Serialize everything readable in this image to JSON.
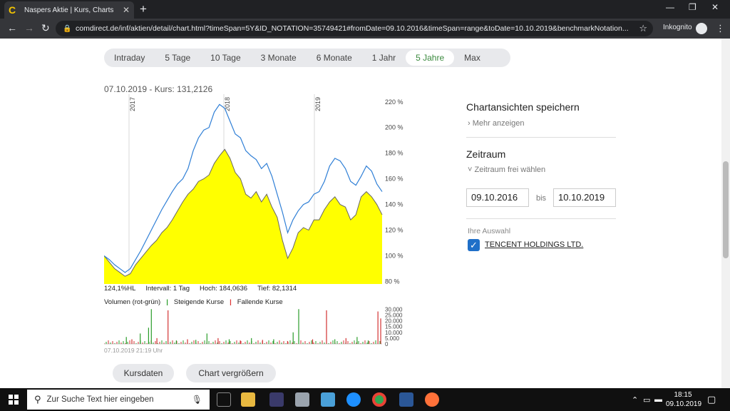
{
  "browser": {
    "tab_title": "Naspers Aktie | Kurs, Charts & Er",
    "url": "comdirect.de/inf/aktien/detail/chart.html?timeSpan=5Y&ID_NOTATION=35749421#fromDate=09.10.2016&timeSpan=range&toDate=10.10.2019&benchmarkNotation...",
    "incognito_label": "Inkognito"
  },
  "range_tabs": [
    {
      "label": "Intraday",
      "active": false
    },
    {
      "label": "5 Tage",
      "active": false
    },
    {
      "label": "10 Tage",
      "active": false
    },
    {
      "label": "3 Monate",
      "active": false
    },
    {
      "label": "6 Monate",
      "active": false
    },
    {
      "label": "1 Jahr",
      "active": false
    },
    {
      "label": "5 Jahre",
      "active": true
    },
    {
      "label": "Max",
      "active": false
    }
  ],
  "quote": {
    "date": "07.10.2019",
    "text": "- Kurs: 131,2126"
  },
  "stats": {
    "hl": "124,1%HL",
    "interval": "Intervall: 1 Tag",
    "hoch": "Hoch: 184,0636",
    "tief": "Tief: 82,1314"
  },
  "volume_legend": {
    "label": "Volumen (rot-grün)",
    "rising": "Steigende Kurse",
    "falling": "Fallende Kurse"
  },
  "timestamp": "07.10.2019 21:19 Uhr",
  "buttons": {
    "kursdaten": "Kursdaten",
    "vergroessern": "Chart vergrößern"
  },
  "right_panel": {
    "save_title": "Chartansichten speichern",
    "more_link": "Mehr anzeigen",
    "zeitraum_title": "Zeitraum",
    "zeitraum_link": "Zeitraum frei wählen",
    "from_date": "09.10.2016",
    "bis": "bis",
    "to_date": "10.10.2019",
    "selection_label": "Ihre Auswahl",
    "company": "TENCENT HOLDINGS LTD."
  },
  "taskbar": {
    "search_placeholder": "Zur Suche Text hier eingeben",
    "time": "18:15",
    "date": "09.10.2019"
  },
  "colors": {
    "area_fill": "#ffff00",
    "naspers_line": "#666666",
    "benchmark_line": "#2f7fd6",
    "active_tab_text": "#3b8a3e",
    "rising": "#2a9d2a",
    "falling": "#d33333"
  },
  "chart_data": {
    "type": "area",
    "x_tick_labels": [
      "2017",
      "2018",
      "2019"
    ],
    "y_ticks": [
      "80 %",
      "100 %",
      "120 %",
      "140 %",
      "160 %",
      "180 %",
      "200 %",
      "220 %"
    ],
    "ylim": [
      78,
      226
    ],
    "series": [
      {
        "name": "",
        "style": "area",
        "values": [
          100,
          95,
          90,
          87,
          84,
          86,
          93,
          98,
          103,
          108,
          112,
          118,
          122,
          128,
          135,
          142,
          148,
          152,
          158,
          160,
          163,
          172,
          178,
          183,
          176,
          165,
          160,
          148,
          145,
          150,
          142,
          148,
          138,
          130,
          112,
          98,
          106,
          118,
          122,
          120,
          128,
          128,
          136,
          142,
          146,
          140,
          138,
          128,
          132,
          146,
          150,
          146,
          140,
          132
        ]
      },
      {
        "name": "",
        "style": "line",
        "values": [
          100,
          97,
          93,
          90,
          87,
          90,
          97,
          104,
          112,
          120,
          128,
          136,
          143,
          150,
          156,
          160,
          168,
          182,
          192,
          198,
          200,
          212,
          218,
          215,
          205,
          195,
          192,
          182,
          178,
          175,
          168,
          172,
          162,
          148,
          134,
          118,
          128,
          135,
          140,
          142,
          148,
          150,
          158,
          170,
          176,
          174,
          168,
          158,
          155,
          162,
          170,
          166,
          156,
          150
        ]
      }
    ],
    "volume": {
      "y_ticks": [
        "30.000",
        "25.000",
        "20.000",
        "15.000",
        "10.000",
        "5.000",
        "0"
      ],
      "ylim": [
        0,
        32000
      ],
      "bars": [
        {
          "x": 0.08,
          "v": 6000,
          "dir": "up"
        },
        {
          "x": 0.1,
          "v": 4000,
          "dir": "down"
        },
        {
          "x": 0.13,
          "v": 9000,
          "dir": "up"
        },
        {
          "x": 0.16,
          "v": 14000,
          "dir": "up"
        },
        {
          "x": 0.17,
          "v": 30000,
          "dir": "up"
        },
        {
          "x": 0.19,
          "v": 5000,
          "dir": "down"
        },
        {
          "x": 0.23,
          "v": 29000,
          "dir": "down"
        },
        {
          "x": 0.26,
          "v": 3000,
          "dir": "up"
        },
        {
          "x": 0.3,
          "v": 4000,
          "dir": "down"
        },
        {
          "x": 0.33,
          "v": 3500,
          "dir": "up"
        },
        {
          "x": 0.37,
          "v": 9000,
          "dir": "up"
        },
        {
          "x": 0.41,
          "v": 5000,
          "dir": "down"
        },
        {
          "x": 0.45,
          "v": 4000,
          "dir": "up"
        },
        {
          "x": 0.49,
          "v": 3000,
          "dir": "down"
        },
        {
          "x": 0.53,
          "v": 5000,
          "dir": "up"
        },
        {
          "x": 0.57,
          "v": 3500,
          "dir": "down"
        },
        {
          "x": 0.61,
          "v": 4000,
          "dir": "up"
        },
        {
          "x": 0.66,
          "v": 2500,
          "dir": "down"
        },
        {
          "x": 0.68,
          "v": 10000,
          "dir": "up"
        },
        {
          "x": 0.7,
          "v": 30000,
          "dir": "up"
        },
        {
          "x": 0.75,
          "v": 4000,
          "dir": "down"
        },
        {
          "x": 0.8,
          "v": 29000,
          "dir": "down"
        },
        {
          "x": 0.83,
          "v": 4000,
          "dir": "up"
        },
        {
          "x": 0.87,
          "v": 5000,
          "dir": "down"
        },
        {
          "x": 0.91,
          "v": 6000,
          "dir": "up"
        },
        {
          "x": 0.95,
          "v": 3000,
          "dir": "up"
        },
        {
          "x": 0.985,
          "v": 28000,
          "dir": "down"
        },
        {
          "x": 0.995,
          "v": 22000,
          "dir": "down"
        }
      ]
    }
  }
}
